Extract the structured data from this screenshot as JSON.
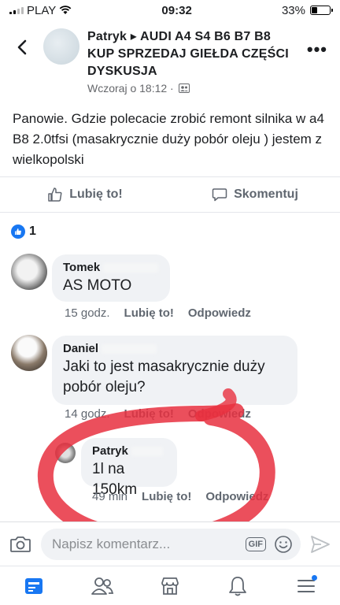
{
  "status": {
    "carrier": "PLAY",
    "time": "09:32",
    "battery": "33%",
    "battery_level": 0.33
  },
  "header": {
    "title": "Patryk ▸ AUDI A4 S4 B6 B7 B8 KUP SPRZEDAJ GIEŁDA CZĘŚCI DYSKUSJA",
    "timestamp": "Wczoraj o 18:12 ·"
  },
  "post": {
    "text": "Panowie. Gdzie polecacie zrobić  remont silnika w a4 B8 2.0tfsi (masakrycznie duży pobór oleju ) jestem z wielkopolski"
  },
  "actions": {
    "like": "Lubię to!",
    "comment": "Skomentuj"
  },
  "reactions": {
    "count": "1"
  },
  "comments": [
    {
      "name": "Tomek",
      "text": "AS MOTO",
      "time": "15 godz.",
      "like": "Lubię to!",
      "reply": "Odpowiedz"
    },
    {
      "name": "Daniel",
      "text": "Jaki to jest masakrycznie duży pobór oleju?",
      "time": "14 godz.",
      "like": "Lubię to!",
      "reply": "Odpowiedz"
    },
    {
      "name": "Patryk",
      "text": "1l na 150km",
      "time": "49 min",
      "like": "Lubię to!",
      "reply": "Odpowiedz"
    }
  ],
  "composer": {
    "placeholder": "Napisz komentarz...",
    "gif": "GIF"
  },
  "colors": {
    "accent": "#1877f2",
    "circle": "#e8303f"
  }
}
